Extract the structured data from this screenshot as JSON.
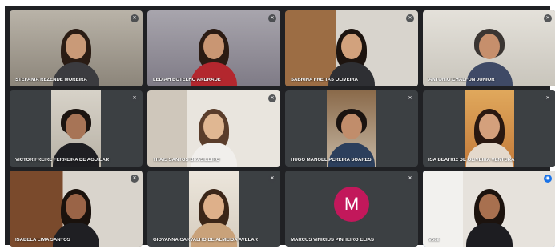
{
  "participants": [
    {
      "name": "STEFANIA REZENDE MOREIRA",
      "muted": true
    },
    {
      "name": "LEDIAH BOTELHO ANDRADE",
      "muted": true
    },
    {
      "name": "SABRINA FREITAS OLIVEIRA",
      "muted": true
    },
    {
      "name": "ANTONIO CHALFUN JUNIOR",
      "muted": true
    },
    {
      "name": "VICTOR FREIRE FERREIRA DE AGUILAR",
      "muted": true
    },
    {
      "name": "THAIS SANTOS BRASILEIRO",
      "muted": true
    },
    {
      "name": "HUGO MANOEL PEREIRA SOARES",
      "muted": true
    },
    {
      "name": "ISA BEATRIZ DE OLIVEIRA VENTURA",
      "muted": true
    },
    {
      "name": "ISABELA LIMA SANTOS",
      "muted": true
    },
    {
      "name": "GIOVANNA CARVALHO DE ALMEIDA AVELAR",
      "muted": true
    },
    {
      "name": "MARCUS VINICIUS PINHEIRO ELIAS",
      "muted": true,
      "avatar_letter": "M",
      "avatar_color": "#c2185b"
    },
    {
      "name": "Você",
      "muted": false,
      "speaking": true
    }
  ],
  "icons": {
    "muted": "mic-off-icon",
    "speaking": "sound-wave-icon"
  },
  "colors": {
    "background": "#202124",
    "tile": "#3c4043",
    "speaking_border": "#8ab4f8",
    "speaking_badge": "#1a73e8"
  }
}
